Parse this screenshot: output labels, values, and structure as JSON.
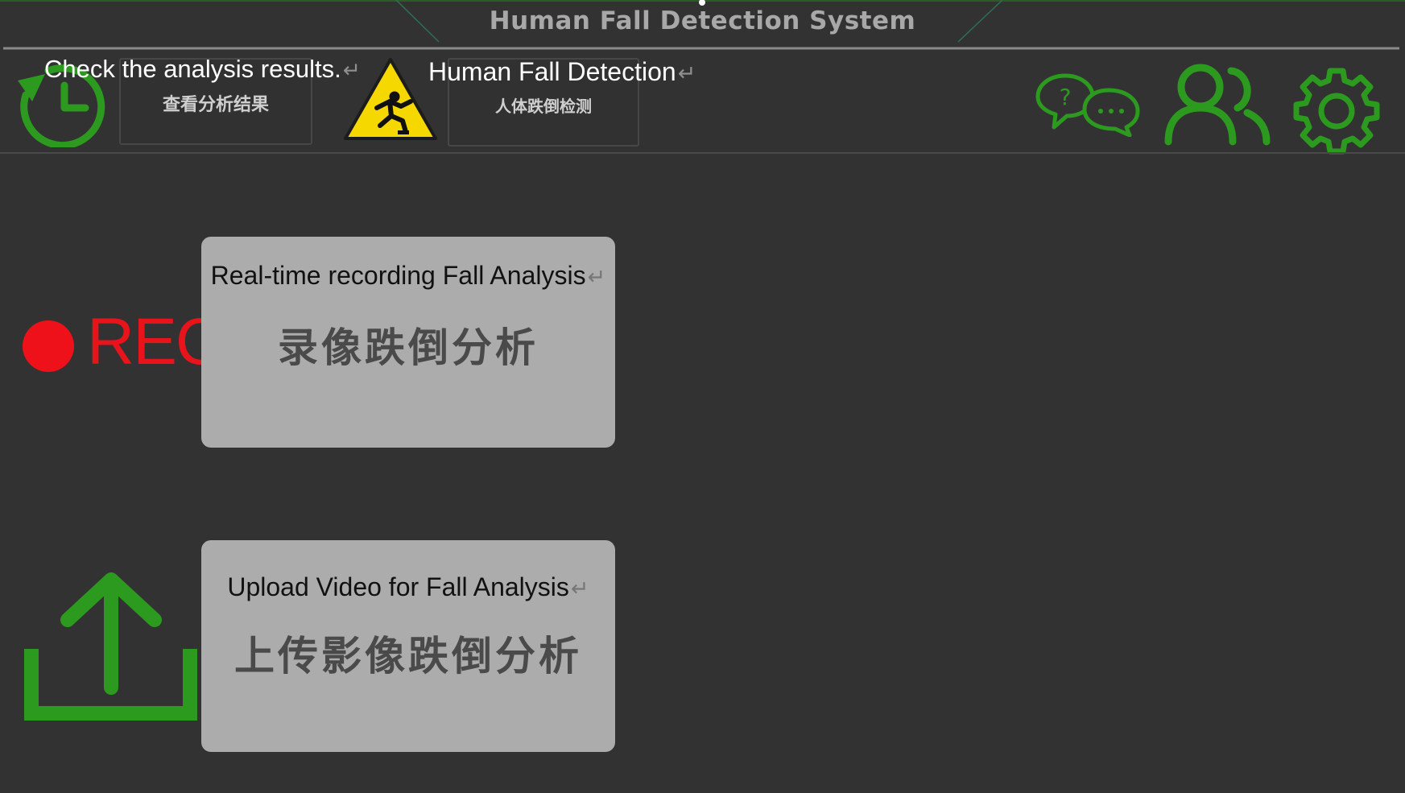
{
  "window": {
    "title": "Human Fall Detection System"
  },
  "toolbar": {
    "history": {
      "icon": "history-clock-icon",
      "label_cn": "查看分析结果",
      "label_en": "Check the analysis results."
    },
    "fall_detection": {
      "icon": "fall-warning-icon",
      "label_cn": "人体跌倒检测",
      "label_en": "Human Fall Detection"
    },
    "right_icons": [
      "help-chat-icon",
      "users-icon",
      "settings-gear-icon"
    ]
  },
  "actions": {
    "record": {
      "icon": "record-dot-icon",
      "badge": "REC",
      "label_en": "Real-time recording Fall Analysis",
      "label_cn": "录像跌倒分析"
    },
    "upload": {
      "icon": "upload-icon",
      "label_en": "Upload Video for Fall Analysis",
      "label_cn": "上传影像跌倒分析"
    }
  },
  "colors": {
    "background": "#323232",
    "accent_green": "#2c9a1f",
    "rec_red": "#e8131b",
    "card": "#acacac",
    "warning_yellow": "#f5d800"
  }
}
